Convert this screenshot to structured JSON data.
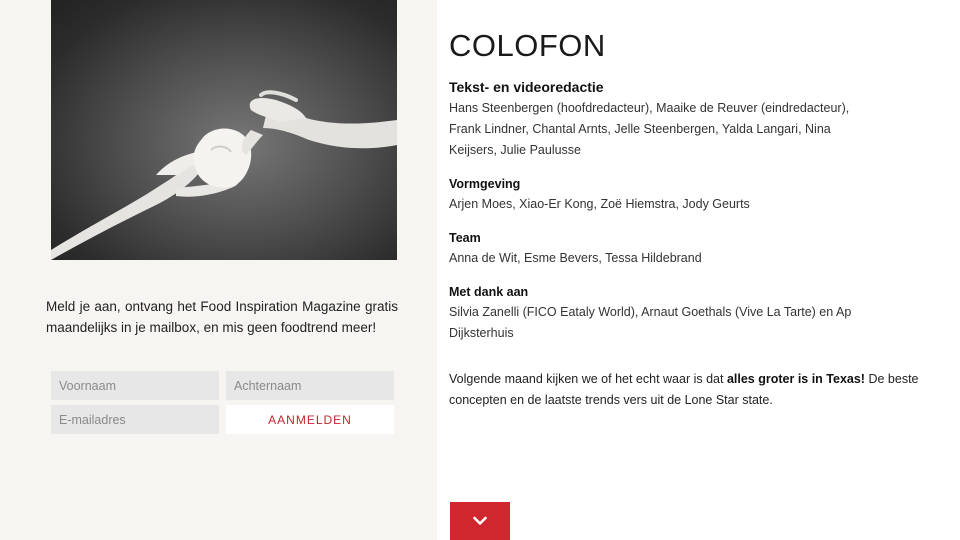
{
  "promo": {
    "text": "Meld je aan, ontvang het Food Inspiration Magazine gratis maandelijks in je mailbox, en mis geen foodtrend meer!"
  },
  "form": {
    "first_name_placeholder": "Voornaam",
    "last_name_placeholder": "Achternaam",
    "email_placeholder": "E-mailadres",
    "submit_label": "AANMELDEN"
  },
  "colofon": {
    "title": "COLOFON",
    "sections": [
      {
        "heading": "Tekst- en videoredactie",
        "text": "Hans Steenbergen (hoofdredacteur), Maaike de Reuver (eindredacteur), Frank Lindner, Chantal Arnts, Jelle Steenbergen, Yalda Langari, Nina Keijsers, Julie Paulusse"
      },
      {
        "heading": "Vormgeving",
        "text": "Arjen Moes, Xiao-Er Kong, Zoë Hiemstra, Jody Geurts"
      },
      {
        "heading": "Team",
        "text": "Anna de Wit, Esme Bevers, Tessa Hildebrand"
      },
      {
        "heading": "Met dank aan",
        "text": "Silvia Zanelli (FICO Eataly World), Arnaut Goethals (Vive La Tarte) en Ap Dijksterhuis"
      }
    ],
    "closing_before": "Volgende maand kijken we of het echt waar is dat ",
    "closing_bold": "alles groter is in Texas!",
    "closing_after": " De beste concepten en de laatste trends vers uit de Lone Star state."
  },
  "icons": {
    "scroll_down": "chevron-down-icon"
  },
  "colors": {
    "accent": "#d0262d",
    "left_panel_bg": "#f6f5f2",
    "input_bg": "#e7e7e7"
  }
}
